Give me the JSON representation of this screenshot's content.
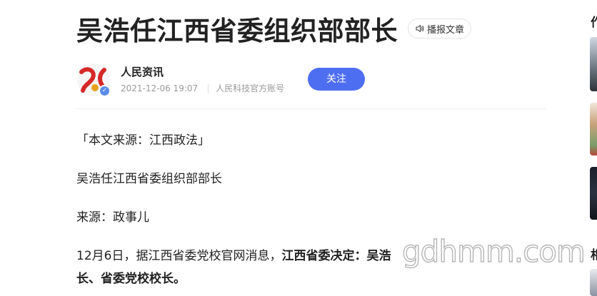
{
  "article": {
    "title": "吴浩任江西省委组织部部长",
    "read_aloud_label": "播报文章",
    "author": {
      "name": "人民资讯",
      "date": "2021-12-06 19:07",
      "account_type": "人民科技官方账号",
      "follow_label": "关注"
    },
    "paragraphs": {
      "source": "「本文来源：江西政法」",
      "headline": "吴浩任江西省委组织部部长",
      "via": "来源：政事儿",
      "body_normal": "12月6日，据江西省委党校官网消息，",
      "body_bold": "江西省委决定：吴浩",
      "body_cont": "长、省委党校校长。"
    },
    "watermark": "gdhmm.com"
  },
  "sidebar": {
    "title_1": "作",
    "title_2": "相"
  },
  "colors": {
    "accent": "#4e6ef2",
    "verified": "#5b8de6",
    "text": "#222222",
    "meta": "#999999"
  }
}
